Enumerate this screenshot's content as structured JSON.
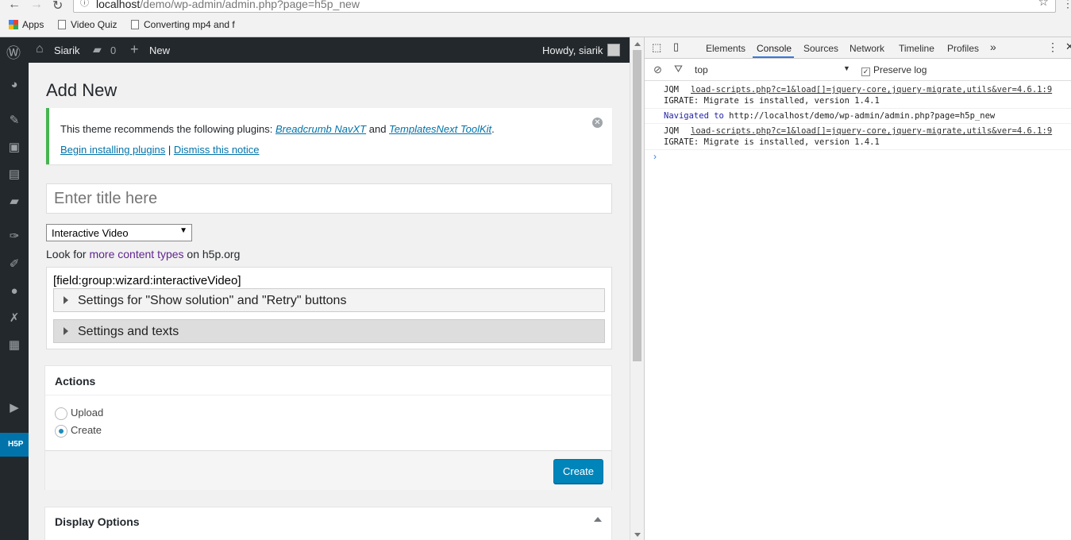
{
  "browser": {
    "url_host": "localhost",
    "url_rest": "/demo/wp-admin/admin.php?page=h5p_new",
    "bookmarks": [
      {
        "label": "Apps"
      },
      {
        "label": "Video Quiz"
      },
      {
        "label": "Converting mp4 and f"
      }
    ]
  },
  "adminbar": {
    "site_name": "Siarik",
    "comments_count": "0",
    "new_label": "New",
    "greeting": "Howdy, siarik"
  },
  "page": {
    "title": "Add New",
    "notice": {
      "text_before": "This theme recommends the following plugins: ",
      "plugin1": "Breadcrumb NavXT",
      "text_and": " and ",
      "plugin2": "TemplatesNext ToolKit",
      "text_end": ".",
      "install_link": "Begin installing plugins",
      "separator": " | ",
      "dismiss_link": "Dismiss this notice"
    },
    "title_placeholder": "Enter title here",
    "content_type": "Interactive Video",
    "lookfor_before": "Look for ",
    "lookfor_link": "more content types",
    "lookfor_after": " on h5p.org",
    "field_label": "[field:group:wizard:interactiveVideo]",
    "groups": [
      {
        "label": "Settings for \"Show solution\" and \"Retry\" buttons"
      },
      {
        "label": "Settings and texts"
      }
    ],
    "actions": {
      "header": "Actions",
      "options": [
        {
          "label": "Upload",
          "selected": false
        },
        {
          "label": "Create",
          "selected": true
        }
      ],
      "button": "Create"
    },
    "display_options_header": "Display Options"
  },
  "devtools": {
    "tabs": [
      "Elements",
      "Console",
      "Sources",
      "Network",
      "Timeline",
      "Profiles"
    ],
    "active_tab": "Console",
    "more_tabs": "»",
    "context": "top",
    "preserve_log_label": "Preserve log",
    "preserve_log_checked": true,
    "logs": [
      {
        "prefix": "JQM",
        "source": "load-scripts.php?c=1&load[]=jquery-core,jquery-migrate,utils&ver=4.6.1:9",
        "message": "IGRATE: Migrate is installed, version 1.4.1"
      },
      {
        "navigated": "Navigated to",
        "nav_url": " http://localhost/demo/wp-admin/admin.php?page=h5p_new"
      },
      {
        "prefix": "JQM",
        "source": "load-scripts.php?c=1&load[]=jquery-core,jquery-migrate,utils&ver=4.6.1:9",
        "message": "IGRATE: Migrate is installed, version 1.4.1"
      }
    ],
    "prompt": "›"
  },
  "colors": {
    "admin_dark": "#23282d",
    "wp_blue": "#0073aa",
    "button_blue": "#0085ba",
    "notice_green": "#46b450",
    "link_purple": "#61268f",
    "devtools_accent": "#3879d9"
  }
}
